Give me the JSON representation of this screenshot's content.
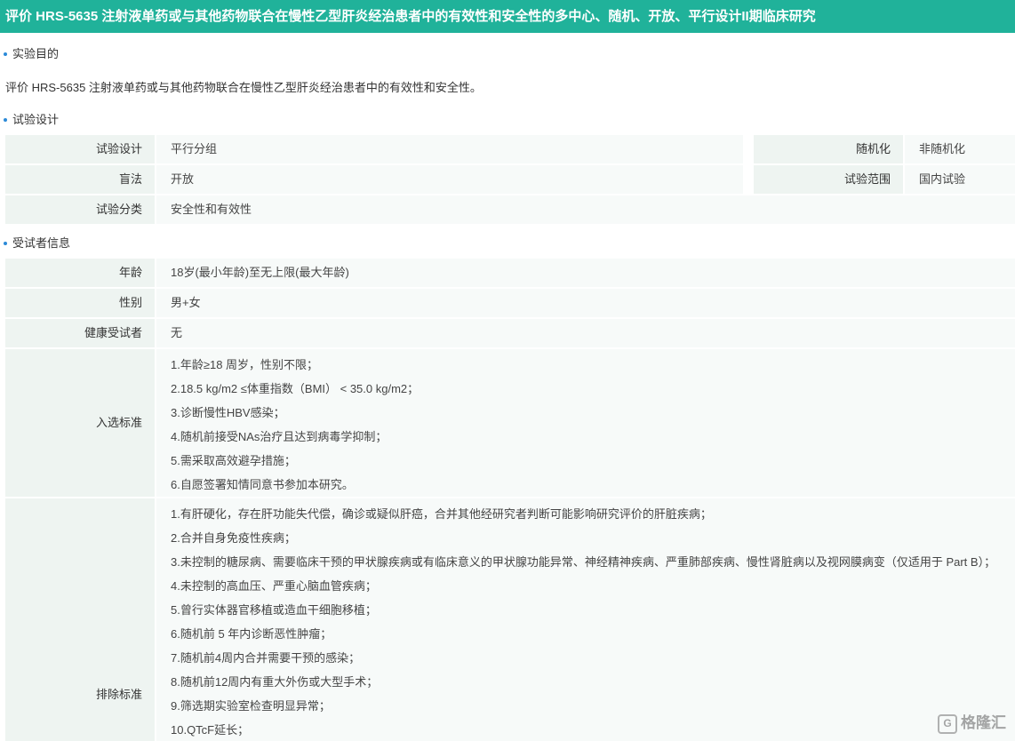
{
  "title": "评价 HRS-5635 注射液单药或与其他药物联合在慢性乙型肝炎经治患者中的有效性和安全性的多中心、随机、开放、平行设计II期临床研究",
  "sections": {
    "purpose": "实验目的",
    "design": "试验设计",
    "subjects": "受试者信息"
  },
  "purpose_text": "评价 HRS-5635 注射液单药或与其他药物联合在慢性乙型肝炎经治患者中的有效性和安全性。",
  "design": {
    "rows": [
      {
        "label": "试验设计",
        "value": "平行分组",
        "label2": "随机化",
        "value2": "非随机化"
      },
      {
        "label": "盲法",
        "value": "开放",
        "label2": "试验范围",
        "value2": "国内试验"
      },
      {
        "label": "试验分类",
        "value": "安全性和有效性"
      }
    ]
  },
  "subjects": {
    "age_label": "年龄",
    "age_value": "18岁(最小年龄)至无上限(最大年龄)",
    "sex_label": "性别",
    "sex_value": "男+女",
    "healthy_label": "健康受试者",
    "healthy_value": "无",
    "inclusion_label": "入选标准",
    "inclusion": [
      "1.年龄≥18 周岁，性别不限；",
      "2.18.5 kg/m2 ≤体重指数（BMI） < 35.0 kg/m2；",
      "3.诊断慢性HBV感染；",
      "4.随机前接受NAs治疗且达到病毒学抑制；",
      "5.需采取高效避孕措施；",
      "6.自愿签署知情同意书参加本研究。"
    ],
    "exclusion_label": "排除标准",
    "exclusion": [
      "1.有肝硬化，存在肝功能失代偿，确诊或疑似肝癌，合并其他经研究者判断可能影响研究评价的肝脏疾病；",
      "2.合并自身免疫性疾病；",
      "3.未控制的糖尿病、需要临床干预的甲状腺疾病或有临床意义的甲状腺功能异常、神经精神疾病、严重肺部疾病、慢性肾脏病以及视网膜病变（仅适用于 Part B）；",
      "4.未控制的高血压、严重心脑血管疾病；",
      "5.曾行实体器官移植或造血干细胞移植；",
      "6.随机前 5 年内诊断恶性肿瘤；",
      "7.随机前4周内合并需要干预的感染；",
      "8.随机前12周内有重大外伤或大型手术；",
      "9.筛选期实验室检查明显异常；",
      "10.QTcF延长；"
    ]
  },
  "watermark": "格隆汇"
}
